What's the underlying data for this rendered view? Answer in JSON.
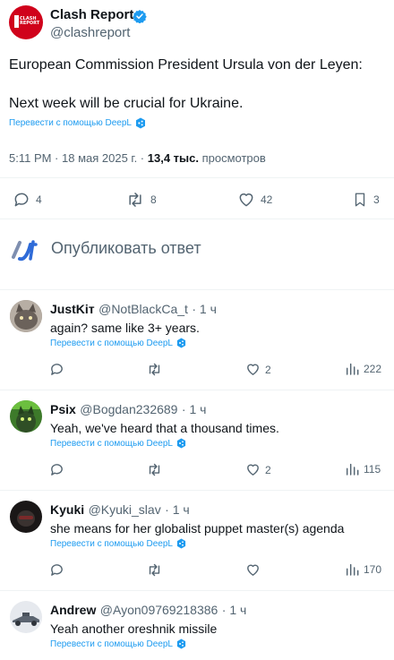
{
  "tweet": {
    "author_name": "Clash Report",
    "author_handle": "@clashreport",
    "avatar_text": "CLASH REPORT",
    "text_line1": "European Commission President Ursula von der Leyen:",
    "text_line2": "Next week will be crucial for Ukraine.",
    "translate_label": "Перевести с помощью DeepL",
    "time": "5:11 PM · 18 мая 2025 г. · ",
    "views_count": "13,4 тыс.",
    "views_label": " просмотров",
    "actions": {
      "replies": "4",
      "retweets": "8",
      "likes": "42",
      "bookmarks": "3"
    }
  },
  "reply_box": {
    "placeholder": "Опубликовать ответ"
  },
  "replies": [
    {
      "name": "JustKіт",
      "handle": "@NotBlackCa_t",
      "time": "· 1 ч",
      "text": "again? same like 3+ years.",
      "translate": "Перевести с помощью DeepL",
      "likes": "2",
      "views": "222"
    },
    {
      "name": "Psix",
      "handle": "@Bogdan232689",
      "time": "· 1 ч",
      "text": "Yeah, we've heard that a thousand times.",
      "translate": "Перевести с помощью DeepL",
      "likes": "2",
      "views": "115"
    },
    {
      "name": "Kyuki",
      "handle": "@Kyuki_slav",
      "time": "· 1 ч",
      "text": "she means for her globalist puppet master(s) agenda",
      "translate": "Перевести с помощью DeepL",
      "likes": "",
      "views": "170"
    },
    {
      "name": "Andrew",
      "handle": "@Ayon09769218386",
      "time": "· 1 ч",
      "text": "Yeah another oreshnik missile",
      "translate": "Перевести с помощью DeepL"
    }
  ],
  "colors": {
    "accent": "#1d9bf0",
    "text": "#0f1419",
    "muted": "#536471",
    "avatar_red": "#d0021b"
  }
}
